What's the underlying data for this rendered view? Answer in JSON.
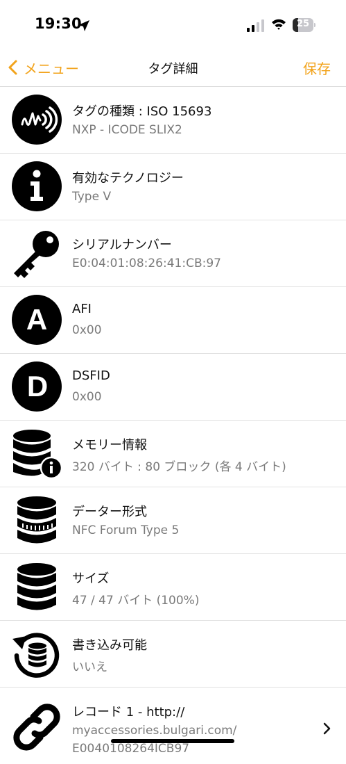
{
  "status": {
    "time": "19:30",
    "battery": "25",
    "battery_level": 0.25
  },
  "nav": {
    "back_label": "メニュー",
    "title": "タグ詳細",
    "save_label": "保存"
  },
  "rows": [
    {
      "icon": "nfc-wave-icon",
      "title": "タグの種類 : ISO 15693",
      "value": "NXP - ICODE SLIX2"
    },
    {
      "icon": "info-icon",
      "title": "有効なテクノロジー",
      "value": "Type V"
    },
    {
      "icon": "key-icon",
      "title": "シリアルナンバー",
      "value": "E0:04:01:08:26:41:CB:97"
    },
    {
      "icon": "letter-a-icon",
      "icon_letter": "A",
      "title": "AFI",
      "value": "0x00"
    },
    {
      "icon": "letter-d-icon",
      "icon_letter": "D",
      "title": "DSFID",
      "value": "0x00"
    },
    {
      "icon": "database-info-icon",
      "title": "メモリー情報",
      "value": "320 バイト : 80 ブロック (各 4 バイト)"
    },
    {
      "icon": "database-format-icon",
      "title": "データー形式",
      "value": "NFC Forum Type 5"
    },
    {
      "icon": "database-icon",
      "title": "サイズ",
      "value": "47 / 47 バイト (100%)"
    },
    {
      "icon": "database-rewrite-icon",
      "title": "書き込み可能",
      "value": "いいえ"
    },
    {
      "icon": "link-icon",
      "title": "レコード 1 - http://",
      "value": "myaccessories.bulgari.com/",
      "value2": "E0040108264ICB97"
    }
  ],
  "colors": {
    "accent": "#f2a31b",
    "icon": "#000000",
    "secondary_text": "#7a7a7a"
  }
}
